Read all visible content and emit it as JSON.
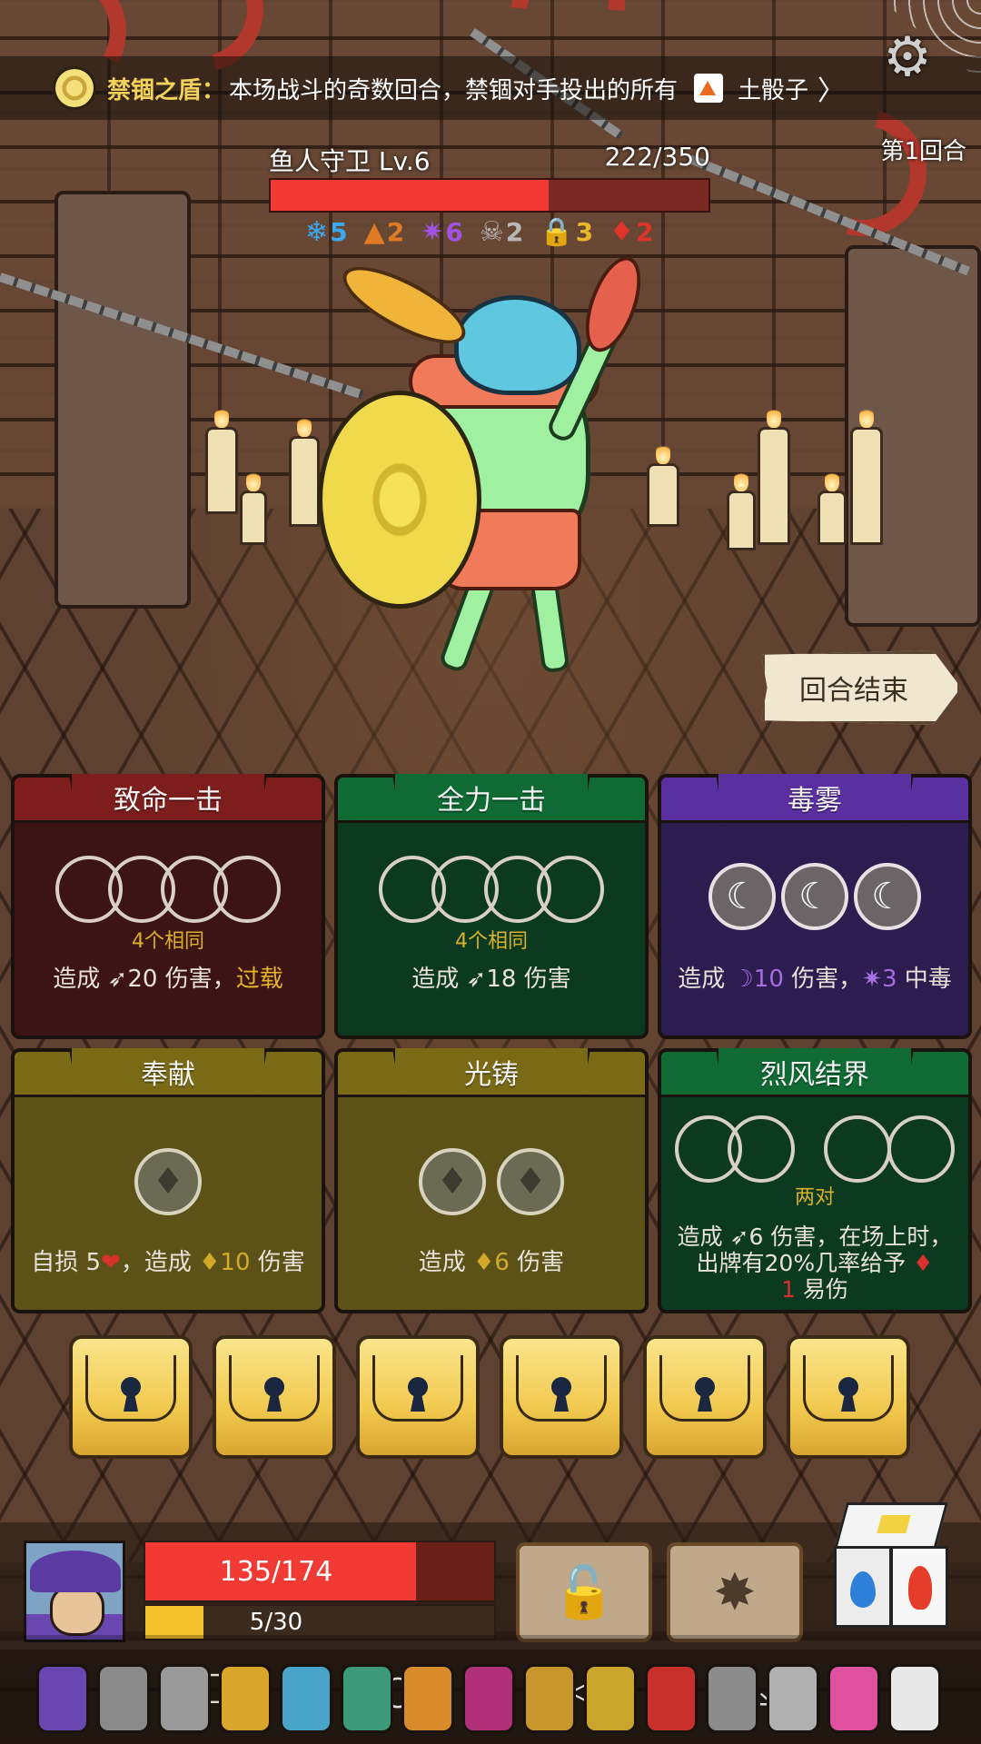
{
  "banner": {
    "relic_name": "禁锢之盾：",
    "relic_desc": "本场战斗的奇数回合，禁锢对手投出的所有",
    "dice_name": "土骰子",
    "chevron": "〉",
    "relic_icon": "shield-coin-icon",
    "dice_icon": "earth-dice-icon"
  },
  "settings": {
    "icon": "gear-icon",
    "glyph": "⚙"
  },
  "round_label": "第1回合",
  "enemy": {
    "name": "鱼人守卫  Lv.6",
    "hp_text": "222/350",
    "hp_current": 222,
    "hp_max": 350,
    "statuses": [
      {
        "icon": "snowflake-icon",
        "glyph": "❄",
        "value": "5",
        "color": "#3aa9f0"
      },
      {
        "icon": "flame-icon",
        "glyph": "▲",
        "value": "2",
        "color": "#e07a24"
      },
      {
        "icon": "poison-splat-icon",
        "glyph": "✷",
        "value": "6",
        "color": "#a052e0"
      },
      {
        "icon": "skull-icon",
        "glyph": "☠",
        "value": "2",
        "color": "#b8b8b8"
      },
      {
        "icon": "lock-icon",
        "glyph": "🔒",
        "value": "3",
        "color": "#e8b72a"
      },
      {
        "icon": "devil-icon",
        "glyph": "♦",
        "value": "2",
        "color": "#e0332a"
      }
    ]
  },
  "end_turn": {
    "label": "回合结束"
  },
  "cards": [
    {
      "title": "致命一击",
      "condition": "4个相同",
      "effect_parts": [
        "造成 ",
        "➶20 伤害，",
        "过载"
      ]
    },
    {
      "title": "全力一击",
      "condition": "4个相同",
      "effect_parts": [
        "造成 ➶18 伤害"
      ]
    },
    {
      "title": "毒雾",
      "condition": "",
      "effect_parts": [
        "造成 ",
        "☽10",
        " 伤害，",
        "✷3",
        " 中毒"
      ]
    },
    {
      "title": "奉献",
      "condition": "",
      "effect_parts": [
        "自损 5",
        "❤",
        "，造成 ",
        "♦10",
        " 伤害"
      ]
    },
    {
      "title": "光铸",
      "condition": "",
      "effect_parts": [
        "造成 ",
        "♦6",
        " 伤害"
      ]
    },
    {
      "title": "烈风结界",
      "condition": "两对",
      "effect_parts": [
        "造成 ➶6 伤害，在场上时，出牌有20%几率给予 ",
        "♦",
        "",
        "1",
        " 易伤"
      ]
    }
  ],
  "lock_slots_count": 6,
  "player": {
    "hp_text": "135/174",
    "hp_current": 135,
    "hp_max": 174,
    "xp_text": "5/30",
    "xp_current": 5,
    "xp_max": 30,
    "avatar_icon": "wizard-avatar-icon"
  },
  "tools": [
    {
      "icon": "unlock-icon",
      "glyph": "🔓"
    },
    {
      "icon": "dice-shatter-icon",
      "glyph": "✸"
    }
  ],
  "die_icon": "elemental-die-icon",
  "items": [
    {
      "icon": "wizard-hat-item-icon",
      "color": "#6a47b0"
    },
    {
      "icon": "skull-scroll-item-icon",
      "color": "#8a8a8a"
    },
    {
      "icon": "scroll-item-icon",
      "color": "#9a9a9a"
    },
    {
      "icon": "gold-ring-item-icon",
      "color": "#d9a52b"
    },
    {
      "icon": "blue-gem-item-icon",
      "color": "#4aa3c9"
    },
    {
      "icon": "green-d20-item-icon",
      "color": "#3c9a7a"
    },
    {
      "icon": "orange-claw-item-icon",
      "color": "#d98a2b"
    },
    {
      "icon": "totem-item-icon",
      "color": "#b0307a"
    },
    {
      "icon": "gold-amulet-item-icon",
      "color": "#c9962b"
    },
    {
      "icon": "gold-chain-item-icon",
      "color": "#c9a52b"
    },
    {
      "icon": "red-gem-item-icon",
      "color": "#c9302b"
    },
    {
      "icon": "grey-scroll-item-icon",
      "color": "#8c8c8c"
    },
    {
      "icon": "wing-item-icon",
      "color": "#b0b0b0"
    },
    {
      "icon": "pink-demon-item-icon",
      "color": "#e050a0"
    },
    {
      "icon": "white-die-item-icon",
      "color": "#e8e8e8"
    }
  ],
  "nav": [
    {
      "icon": "nav-down-icon",
      "glyph": "⌄"
    },
    {
      "icon": "nav-recent-icon",
      "glyph": "☐"
    },
    {
      "icon": "nav-home-icon",
      "glyph": "○"
    },
    {
      "icon": "nav-back-icon",
      "glyph": "◁"
    },
    {
      "icon": "nav-download-icon",
      "glyph": "⤓"
    }
  ]
}
